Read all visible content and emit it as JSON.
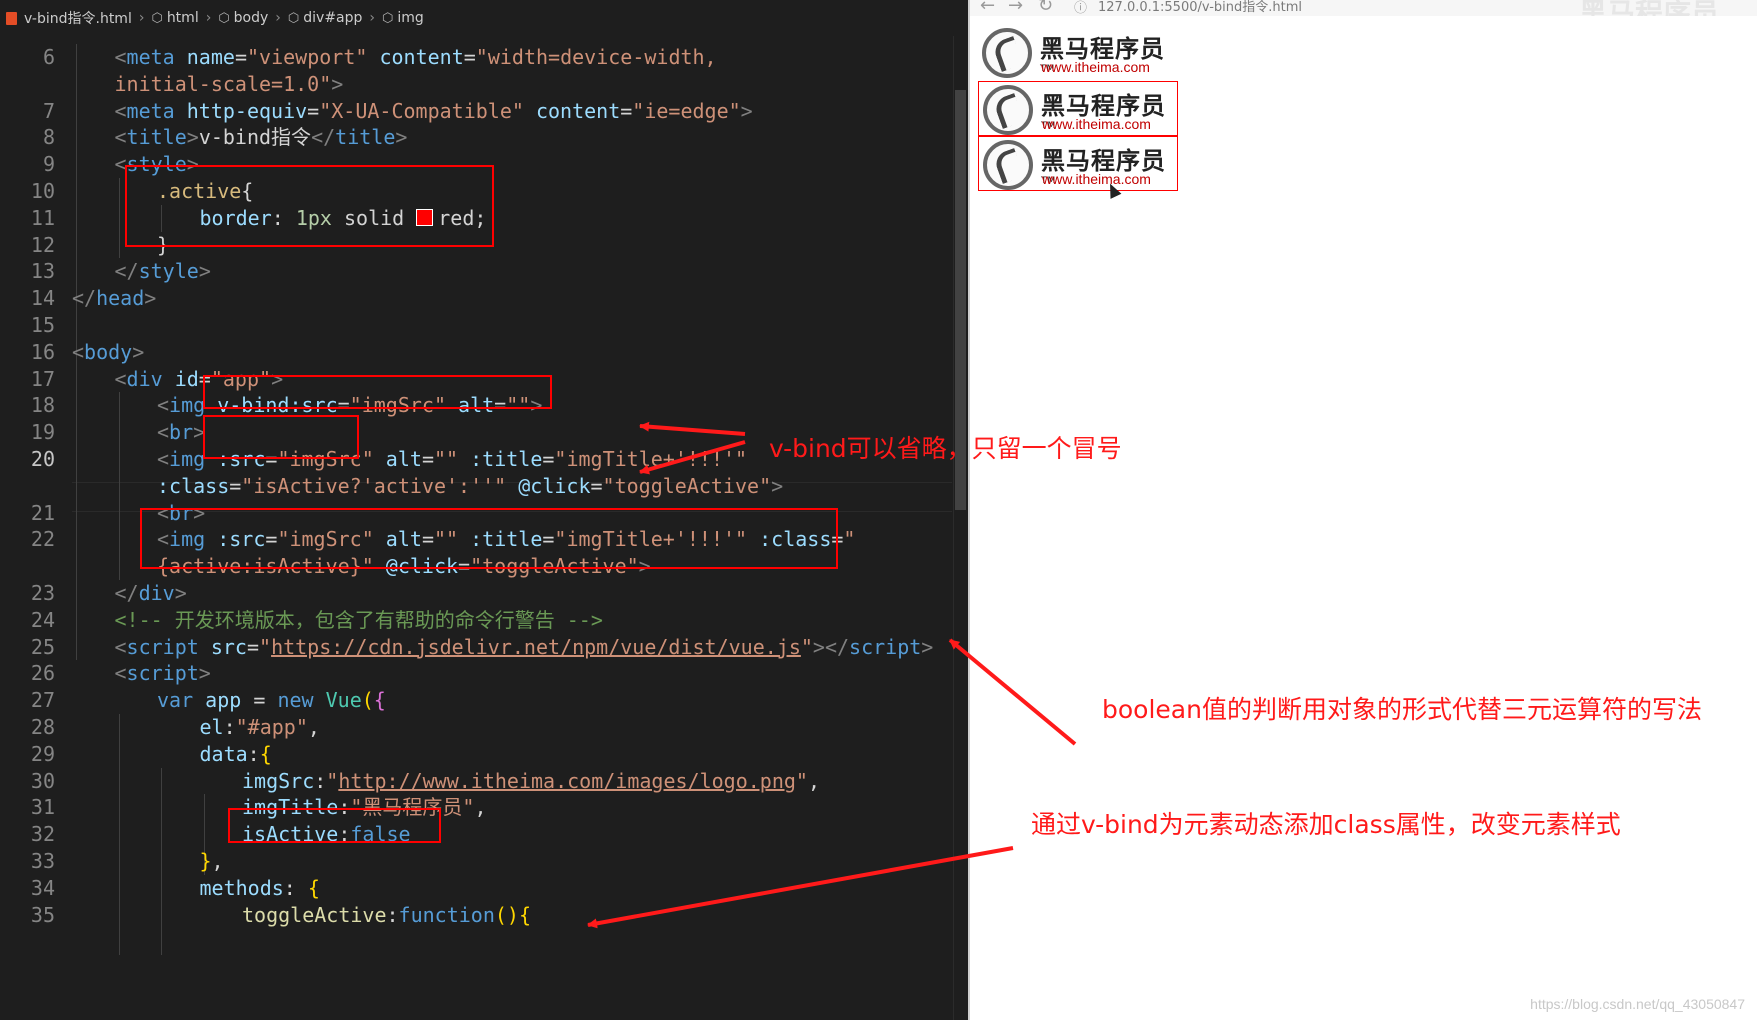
{
  "breadcrumb": [
    "v-bind指令.html",
    "html",
    "body",
    "div#app",
    "img"
  ],
  "lines": [
    {
      "n": "6",
      "i": 1,
      "t": [
        [
          "<",
          "br"
        ],
        [
          "meta",
          "tag"
        ],
        [
          " name",
          "attr"
        ],
        [
          "=",
          "plain"
        ],
        [
          "\"viewport\"",
          "str"
        ],
        [
          " content",
          "attr"
        ],
        [
          "=",
          "plain"
        ],
        [
          "\"width=device-width,",
          "str"
        ]
      ]
    },
    {
      "n": "",
      "i": 1,
      "t": [
        [
          "initial-scale=1.0\"",
          "str"
        ],
        [
          ">",
          "br"
        ]
      ]
    },
    {
      "n": "7",
      "i": 1,
      "t": [
        [
          "<",
          "br"
        ],
        [
          "meta",
          "tag"
        ],
        [
          " http-equiv",
          "attr"
        ],
        [
          "=",
          "plain"
        ],
        [
          "\"X-UA-Compatible\"",
          "str"
        ],
        [
          " content",
          "attr"
        ],
        [
          "=",
          "plain"
        ],
        [
          "\"ie=edge\"",
          "str"
        ],
        [
          ">",
          "br"
        ]
      ]
    },
    {
      "n": "8",
      "i": 1,
      "t": [
        [
          "<",
          "br"
        ],
        [
          "title",
          "tag"
        ],
        [
          ">",
          "br"
        ],
        [
          "v-bind指令",
          "plain"
        ],
        [
          "</",
          "br"
        ],
        [
          "title",
          "tag"
        ],
        [
          ">",
          "br"
        ]
      ]
    },
    {
      "n": "9",
      "i": 1,
      "t": [
        [
          "<",
          "br"
        ],
        [
          "style",
          "tag"
        ],
        [
          ">",
          "br"
        ]
      ]
    },
    {
      "n": "10",
      "i": 2,
      "t": [
        [
          ".active",
          "cls"
        ],
        [
          "{",
          "plain"
        ]
      ]
    },
    {
      "n": "11",
      "i": 3,
      "t": [
        [
          "border",
          "prop"
        ],
        [
          ": ",
          "plain"
        ],
        [
          "1px",
          "num"
        ],
        [
          " solid ",
          "plain"
        ],
        [
          "SW",
          ""
        ],
        [
          "red",
          "plain"
        ],
        [
          ";",
          "plain"
        ]
      ]
    },
    {
      "n": "12",
      "i": 2,
      "t": [
        [
          "}",
          "plain"
        ]
      ]
    },
    {
      "n": "13",
      "i": 1,
      "t": [
        [
          "</",
          "br"
        ],
        [
          "style",
          "tag"
        ],
        [
          ">",
          "br"
        ]
      ]
    },
    {
      "n": "14",
      "i": 0,
      "t": [
        [
          "</",
          "br"
        ],
        [
          "head",
          "tag"
        ],
        [
          ">",
          "br"
        ]
      ]
    },
    {
      "n": "15",
      "i": 0,
      "t": []
    },
    {
      "n": "16",
      "i": 0,
      "t": [
        [
          "<",
          "br"
        ],
        [
          "body",
          "tag"
        ],
        [
          ">",
          "br"
        ]
      ]
    },
    {
      "n": "17",
      "i": 1,
      "t": [
        [
          "<",
          "br"
        ],
        [
          "div",
          "tag"
        ],
        [
          " id",
          "attr"
        ],
        [
          "=",
          "plain"
        ],
        [
          "\"app\"",
          "str"
        ],
        [
          ">",
          "br"
        ]
      ]
    },
    {
      "n": "18",
      "i": 2,
      "t": [
        [
          "<",
          "br"
        ],
        [
          "img",
          "tag"
        ],
        [
          " v-bind:src",
          "attr"
        ],
        [
          "=",
          "plain"
        ],
        [
          "\"imgSrc\"",
          "str"
        ],
        [
          " alt",
          "attr"
        ],
        [
          "=",
          "plain"
        ],
        [
          "\"\"",
          "str"
        ],
        [
          ">",
          "br"
        ]
      ]
    },
    {
      "n": "19",
      "i": 2,
      "t": [
        [
          "<",
          "br"
        ],
        [
          "br",
          "tag"
        ],
        [
          ">",
          "br"
        ]
      ]
    },
    {
      "n": "20",
      "i": 2,
      "t": [
        [
          "<",
          "br"
        ],
        [
          "img",
          "tag"
        ],
        [
          " :src",
          "attr"
        ],
        [
          "=",
          "plain"
        ],
        [
          "\"imgSrc\"",
          "str"
        ],
        [
          " alt",
          "attr"
        ],
        [
          "=",
          "plain"
        ],
        [
          "\"\"",
          "str"
        ],
        [
          " :title",
          "attr"
        ],
        [
          "=",
          "plain"
        ],
        [
          "\"imgTitle+'!!!'\"",
          "str"
        ]
      ]
    },
    {
      "n": "",
      "i": 2,
      "t": [
        [
          ":class",
          "attr"
        ],
        [
          "=",
          "plain"
        ],
        [
          "\"isActive?'active':''\"",
          "str"
        ],
        [
          " @click",
          "attr"
        ],
        [
          "=",
          "plain"
        ],
        [
          "\"toggleActive\"",
          "str"
        ],
        [
          ">",
          "br"
        ]
      ]
    },
    {
      "n": "21",
      "i": 2,
      "t": [
        [
          "<",
          "br"
        ],
        [
          "br",
          "tag"
        ],
        [
          ">",
          "br"
        ]
      ]
    },
    {
      "n": "22",
      "i": 2,
      "t": [
        [
          "<",
          "br"
        ],
        [
          "img",
          "tag"
        ],
        [
          " :src",
          "attr"
        ],
        [
          "=",
          "plain"
        ],
        [
          "\"imgSrc\"",
          "str"
        ],
        [
          " alt",
          "attr"
        ],
        [
          "=",
          "plain"
        ],
        [
          "\"\"",
          "str"
        ],
        [
          " :title",
          "attr"
        ],
        [
          "=",
          "plain"
        ],
        [
          "\"imgTitle+'!!!'\"",
          "str"
        ],
        [
          " :class",
          "attr"
        ],
        [
          "=",
          "plain"
        ],
        [
          "\"",
          "str"
        ]
      ]
    },
    {
      "n": "",
      "i": 2,
      "t": [
        [
          "{active:isActive}\"",
          "str"
        ],
        [
          " @click",
          "attr"
        ],
        [
          "=",
          "plain"
        ],
        [
          "\"toggleActive\"",
          "str"
        ],
        [
          ">",
          "br"
        ]
      ]
    },
    {
      "n": "23",
      "i": 1,
      "t": [
        [
          "</",
          "br"
        ],
        [
          "div",
          "tag"
        ],
        [
          ">",
          "br"
        ]
      ]
    },
    {
      "n": "24",
      "i": 1,
      "t": [
        [
          "<!-- 开发环境版本，包含了有帮助的命令行警告 -->",
          "cmt"
        ]
      ]
    },
    {
      "n": "25",
      "i": 1,
      "t": [
        [
          "<",
          "br"
        ],
        [
          "script",
          "tag"
        ],
        [
          " src",
          "attr"
        ],
        [
          "=",
          "plain"
        ],
        [
          "\"",
          "str"
        ],
        [
          "https://cdn.jsdelivr.net/npm/vue/dist/vue.js",
          "url"
        ],
        [
          "\"",
          "str"
        ],
        [
          "></",
          "br"
        ],
        [
          "script",
          "tag"
        ],
        [
          ">",
          "br"
        ]
      ]
    },
    {
      "n": "26",
      "i": 1,
      "t": [
        [
          "<",
          "br"
        ],
        [
          "script",
          "tag"
        ],
        [
          ">",
          "br"
        ]
      ]
    },
    {
      "n": "27",
      "i": 2,
      "t": [
        [
          "var",
          "kw"
        ],
        [
          " app ",
          "prop"
        ],
        [
          "= ",
          "plain"
        ],
        [
          "new",
          "kw"
        ],
        [
          " ",
          "plain"
        ],
        [
          "Vue",
          "ty"
        ],
        [
          "(",
          "brace"
        ],
        [
          "{",
          "purple"
        ]
      ]
    },
    {
      "n": "28",
      "i": 3,
      "t": [
        [
          "el",
          "prop"
        ],
        [
          ":",
          "plain"
        ],
        [
          "\"#app\"",
          "str"
        ],
        [
          ",",
          "plain"
        ]
      ]
    },
    {
      "n": "29",
      "i": 3,
      "t": [
        [
          "data",
          "prop"
        ],
        [
          ":",
          "plain"
        ],
        [
          "{",
          "brace"
        ]
      ]
    },
    {
      "n": "30",
      "i": 4,
      "t": [
        [
          "imgSrc",
          "prop"
        ],
        [
          ":",
          "plain"
        ],
        [
          "\"",
          "str"
        ],
        [
          "http://www.itheima.com/images/logo.png",
          "url"
        ],
        [
          "\"",
          "str"
        ],
        [
          ",",
          "plain"
        ]
      ]
    },
    {
      "n": "31",
      "i": 4,
      "t": [
        [
          "imgTitle",
          "prop"
        ],
        [
          ":",
          "plain"
        ],
        [
          "\"黑马程序员\"",
          "str"
        ],
        [
          ",",
          "plain"
        ]
      ]
    },
    {
      "n": "32",
      "i": 4,
      "t": [
        [
          "isActive",
          "prop"
        ],
        [
          ":",
          "plain"
        ],
        [
          "false",
          "kw"
        ]
      ]
    },
    {
      "n": "33",
      "i": 3,
      "t": [
        [
          "}",
          "brace"
        ],
        [
          ",",
          "plain"
        ]
      ]
    },
    {
      "n": "34",
      "i": 3,
      "t": [
        [
          "methods",
          "prop"
        ],
        [
          ": ",
          "plain"
        ],
        [
          "{",
          "brace"
        ]
      ]
    },
    {
      "n": "35",
      "i": 4,
      "t": [
        [
          "toggleActive",
          "fn"
        ],
        [
          ":",
          "plain"
        ],
        [
          "function",
          "kw"
        ],
        [
          "(){",
          "brace"
        ]
      ]
    }
  ],
  "browser": {
    "url": "127.0.0.1:5500/v-bind指令.html",
    "watermark": "黑马程序员",
    "logo_name": "黑马程序员",
    "logo_tm": "TM",
    "logo_url": "www.itheima.com"
  },
  "annotations": {
    "omit_vbind": "v-bind可以省略，只留一个冒号",
    "boolean_object": "boolean值的判断用对象的形式代替三元运算符的写法",
    "dynamic_class": "通过v-bind为元素动态添加class属性，改变元素样式"
  },
  "csdn_watermark": "https://blog.csdn.net/qq_43050847",
  "colors": {
    "annotation": "#ff1a1a",
    "editor_bg": "#1e1e1e",
    "tag": "#569cd6",
    "string": "#ce9178",
    "attr": "#9cdcfe"
  }
}
